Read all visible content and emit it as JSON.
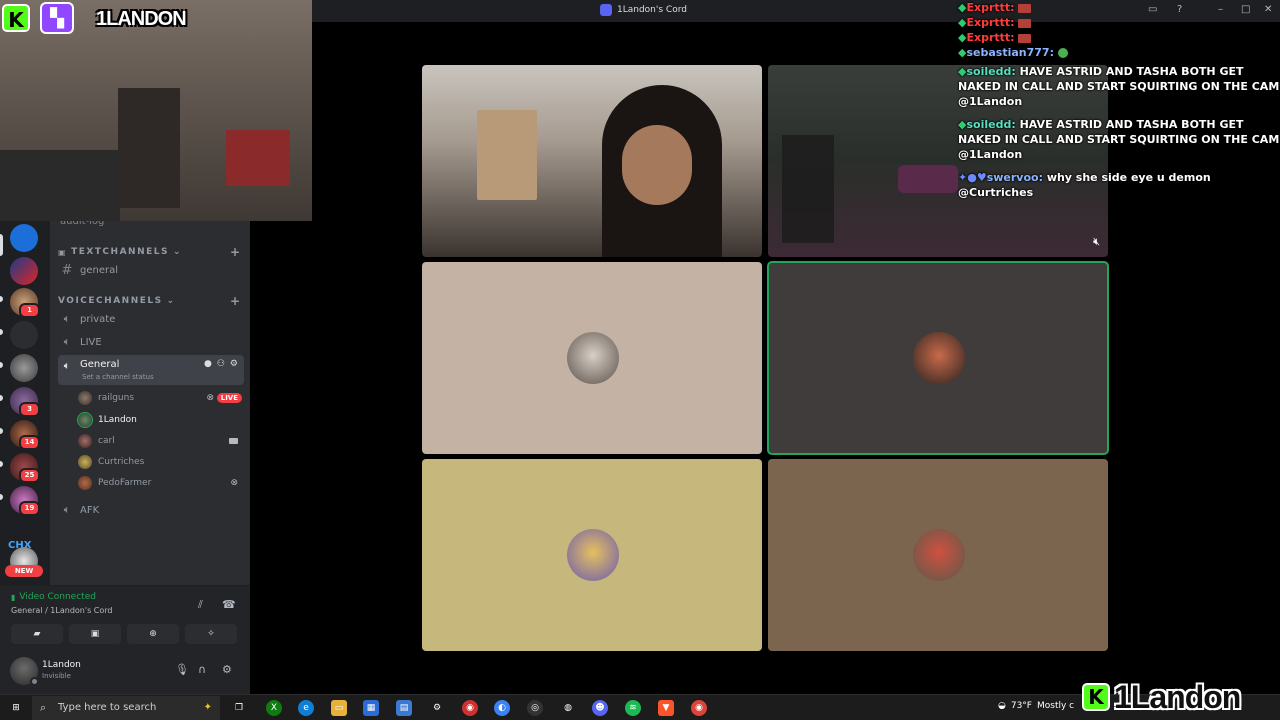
{
  "window": {
    "title": "1Landon's Cord",
    "controls": [
      "inbox-icon",
      "help-icon",
      "minimize-icon",
      "maximize-icon",
      "close-icon"
    ]
  },
  "webcam_overlay": {
    "streamer_name": "1LANDON",
    "logos": [
      "kick-logo",
      "twitch-logo"
    ]
  },
  "servers": [
    {
      "name": "server-1",
      "badge": ""
    },
    {
      "name": "server-2",
      "badge": ""
    },
    {
      "name": "server-3",
      "badge": "1"
    },
    {
      "name": "server-4",
      "badge": ""
    },
    {
      "name": "server-5",
      "badge": ""
    },
    {
      "name": "server-6",
      "badge": "3"
    },
    {
      "name": "server-7",
      "badge": "14"
    },
    {
      "name": "server-8",
      "badge": "25"
    },
    {
      "name": "server-9",
      "badge": "19"
    },
    {
      "name": "server-chx",
      "label": "CHX"
    },
    {
      "name": "server-new",
      "tag": "NEW"
    }
  ],
  "channels": {
    "audit": "audit-log",
    "text_category": "TEXTCHANNELS",
    "text_channels": [
      "general"
    ],
    "voice_category": "VOICECHANNELS",
    "voice_channels": [
      "private",
      "LIVE"
    ],
    "active_voice": {
      "name": "General",
      "status_placeholder": "Set a channel status"
    },
    "voice_users": [
      {
        "name": "railguns",
        "live": "LIVE"
      },
      {
        "name": "1Landon"
      },
      {
        "name": "carl"
      },
      {
        "name": "Curtriches"
      },
      {
        "name": "PedoFarmer"
      }
    ],
    "afk": "AFK"
  },
  "voice_panel": {
    "status": "Video Connected",
    "location": "General / 1Landon's Cord"
  },
  "user_panel": {
    "username": "1Landon",
    "status": "Invisible"
  },
  "chat": [
    {
      "user": "Exprttt:",
      "text": ""
    },
    {
      "user": "Exprttt:",
      "text": ""
    },
    {
      "user": "Exprttt:",
      "text": ""
    },
    {
      "user": "sebastian777:",
      "text": ""
    },
    {
      "user": "soiledd:",
      "text": "HAVE ASTRID AND TASHA BOTH GET NAKED IN CALL AND START SQUIRTING ON THE CAM @1Landon"
    },
    {
      "user": "soiledd:",
      "text": "HAVE ASTRID AND TASHA BOTH GET NAKED IN CALL AND START SQUIRTING ON THE CAM @1Landon"
    },
    {
      "user": "swervoo:",
      "text": "why she side eye u demon @Curtriches"
    }
  ],
  "taskbar": {
    "search_placeholder": "Type here to search",
    "weather": "73°F",
    "weather_desc": "Mostly c"
  },
  "brand_overlay": "1Landon",
  "colors": {
    "discord_bg": "#1e1f22",
    "sidebar": "#2b2d31",
    "accent_green": "#23a55a",
    "live_red": "#f23f43",
    "kick_green": "#53fc18",
    "twitch_purple": "#9146ff"
  }
}
